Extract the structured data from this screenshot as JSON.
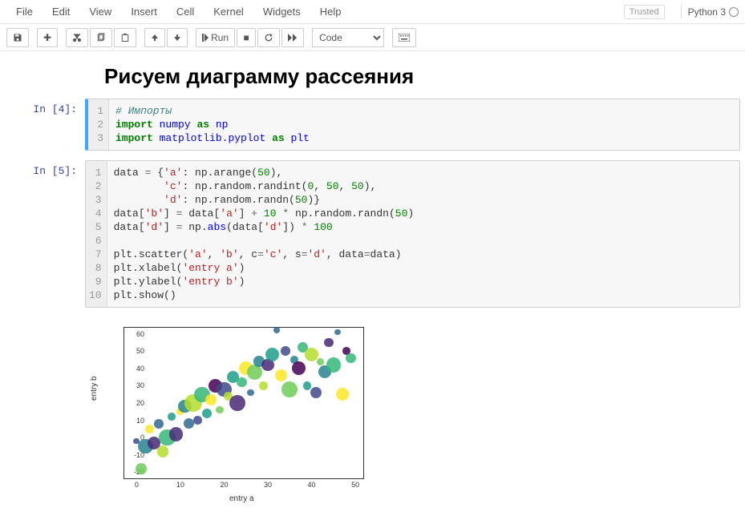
{
  "menubar": {
    "file": "File",
    "edit": "Edit",
    "view": "View",
    "insert": "Insert",
    "cell": "Cell",
    "kernel": "Kernel",
    "widgets": "Widgets",
    "help": "Help"
  },
  "header_right": {
    "trusted": "Trusted",
    "kernel": "Python 3"
  },
  "toolbar": {
    "save": "💾",
    "add": "✚",
    "cut": "✂",
    "copy": "⎘",
    "paste": "📋",
    "up": "▲",
    "down": "▼",
    "run_icon": "▶",
    "run_label": "Run",
    "stop": "■",
    "restart": "⟳",
    "restart_run": "▶▶",
    "command": "⌨",
    "cell_type": "Code"
  },
  "markdown": {
    "title": "Рисуем диаграмму рассеяния"
  },
  "cells": {
    "c1_prompt": "In [4]:",
    "c1_gutter": "1\n2\n3",
    "c1_code_html": "<span class='tok-c'># Импорты</span>\n<span class='tok-k'>import</span> <span class='tok-nn'>numpy</span> <span class='tok-k'>as</span> <span class='tok-nn'>np</span>\n<span class='tok-k'>import</span> <span class='tok-nn'>matplotlib.pyplot</span> <span class='tok-k'>as</span> <span class='tok-nn'>plt</span>",
    "c2_prompt": "In [5]:",
    "c2_gutter": "1\n2\n3\n4\n5\n6\n7\n8\n9\n10",
    "c2_code_html": "data <span class='tok-o'>=</span> {<span class='tok-s'>'a'</span>: np.arange(<span class='tok-m'>50</span>),\n        <span class='tok-s'>'c'</span>: np.random.randint(<span class='tok-m'>0</span>, <span class='tok-m'>50</span>, <span class='tok-m'>50</span>),\n        <span class='tok-s'>'d'</span>: np.random.randn(<span class='tok-m'>50</span>)}\ndata[<span class='tok-s'>'b'</span>] <span class='tok-o'>=</span> data[<span class='tok-s'>'a'</span>] <span class='tok-o'>+</span> <span class='tok-m'>10</span> <span class='tok-o'>*</span> np.random.randn(<span class='tok-m'>50</span>)\ndata[<span class='tok-s'>'d'</span>] <span class='tok-o'>=</span> np.<span class='tok-nn'>abs</span>(data[<span class='tok-s'>'d'</span>]) <span class='tok-o'>*</span> <span class='tok-m'>100</span>\n\nplt.scatter(<span class='tok-s'>'a'</span>, <span class='tok-s'>'b'</span>, c<span class='tok-o'>=</span><span class='tok-s'>'c'</span>, s<span class='tok-o'>=</span><span class='tok-s'>'d'</span>, data<span class='tok-o'>=</span>data)\nplt.xlabel(<span class='tok-s'>'entry a'</span>)\nplt.ylabel(<span class='tok-s'>'entry b'</span>)\nplt.show()"
  },
  "chart_data": {
    "type": "scatter",
    "xlabel": "entry a",
    "ylabel": "entry b",
    "xlim": [
      -3,
      52
    ],
    "ylim": [
      -24,
      64
    ],
    "xticks": [
      0,
      10,
      20,
      30,
      40,
      50
    ],
    "yticks": [
      -20,
      -10,
      0,
      10,
      20,
      30,
      40,
      50,
      60
    ],
    "viridis": [
      "#440154",
      "#482878",
      "#3e4a89",
      "#31688e",
      "#26828e",
      "#1f9e89",
      "#35b779",
      "#6ece58",
      "#b5de2b",
      "#fde725"
    ],
    "points": [
      {
        "x": 0,
        "y": -2,
        "c": 10,
        "s": 40
      },
      {
        "x": 1,
        "y": -18,
        "c": 35,
        "s": 120
      },
      {
        "x": 2,
        "y": -5,
        "c": 20,
        "s": 220
      },
      {
        "x": 3,
        "y": 5,
        "c": 48,
        "s": 80
      },
      {
        "x": 4,
        "y": -3,
        "c": 8,
        "s": 160
      },
      {
        "x": 5,
        "y": 8,
        "c": 15,
        "s": 90
      },
      {
        "x": 6,
        "y": -8,
        "c": 42,
        "s": 140
      },
      {
        "x": 7,
        "y": 0,
        "c": 30,
        "s": 260
      },
      {
        "x": 8,
        "y": 12,
        "c": 25,
        "s": 60
      },
      {
        "x": 9,
        "y": 2,
        "c": 5,
        "s": 200
      },
      {
        "x": 10,
        "y": 15,
        "c": 45,
        "s": 50
      },
      {
        "x": 11,
        "y": 18,
        "c": 22,
        "s": 170
      },
      {
        "x": 12,
        "y": 8,
        "c": 18,
        "s": 110
      },
      {
        "x": 13,
        "y": 20,
        "c": 40,
        "s": 300
      },
      {
        "x": 14,
        "y": 10,
        "c": 12,
        "s": 70
      },
      {
        "x": 15,
        "y": 25,
        "c": 33,
        "s": 240
      },
      {
        "x": 16,
        "y": 14,
        "c": 28,
        "s": 90
      },
      {
        "x": 17,
        "y": 22,
        "c": 49,
        "s": 130
      },
      {
        "x": 18,
        "y": 30,
        "c": 3,
        "s": 180
      },
      {
        "x": 19,
        "y": 16,
        "c": 38,
        "s": 60
      },
      {
        "x": 20,
        "y": 28,
        "c": 14,
        "s": 210
      },
      {
        "x": 21,
        "y": 24,
        "c": 44,
        "s": 80
      },
      {
        "x": 22,
        "y": 35,
        "c": 26,
        "s": 150
      },
      {
        "x": 23,
        "y": 20,
        "c": 7,
        "s": 270
      },
      {
        "x": 24,
        "y": 32,
        "c": 31,
        "s": 100
      },
      {
        "x": 25,
        "y": 40,
        "c": 47,
        "s": 190
      },
      {
        "x": 26,
        "y": 26,
        "c": 19,
        "s": 50
      },
      {
        "x": 27,
        "y": 38,
        "c": 36,
        "s": 230
      },
      {
        "x": 28,
        "y": 44,
        "c": 24,
        "s": 120
      },
      {
        "x": 29,
        "y": 30,
        "c": 41,
        "s": 70
      },
      {
        "x": 30,
        "y": 42,
        "c": 9,
        "s": 160
      },
      {
        "x": 31,
        "y": 48,
        "c": 29,
        "s": 200
      },
      {
        "x": 32,
        "y": 62,
        "c": 16,
        "s": 40
      },
      {
        "x": 33,
        "y": 36,
        "c": 46,
        "s": 140
      },
      {
        "x": 34,
        "y": 50,
        "c": 13,
        "s": 90
      },
      {
        "x": 35,
        "y": 28,
        "c": 39,
        "s": 250
      },
      {
        "x": 36,
        "y": 45,
        "c": 23,
        "s": 60
      },
      {
        "x": 37,
        "y": 40,
        "c": 4,
        "s": 180
      },
      {
        "x": 38,
        "y": 52,
        "c": 34,
        "s": 110
      },
      {
        "x": 39,
        "y": 30,
        "c": 27,
        "s": 70
      },
      {
        "x": 40,
        "y": 48,
        "c": 43,
        "s": 200
      },
      {
        "x": 41,
        "y": 26,
        "c": 11,
        "s": 130
      },
      {
        "x": 42,
        "y": 44,
        "c": 37,
        "s": 50
      },
      {
        "x": 43,
        "y": 38,
        "c": 21,
        "s": 160
      },
      {
        "x": 44,
        "y": 55,
        "c": 6,
        "s": 90
      },
      {
        "x": 45,
        "y": 42,
        "c": 32,
        "s": 220
      },
      {
        "x": 46,
        "y": 61,
        "c": 17,
        "s": 40
      },
      {
        "x": 47,
        "y": 25,
        "c": 48,
        "s": 170
      },
      {
        "x": 48,
        "y": 50,
        "c": 2,
        "s": 60
      },
      {
        "x": 49,
        "y": 46,
        "c": 30,
        "s": 100
      }
    ]
  }
}
